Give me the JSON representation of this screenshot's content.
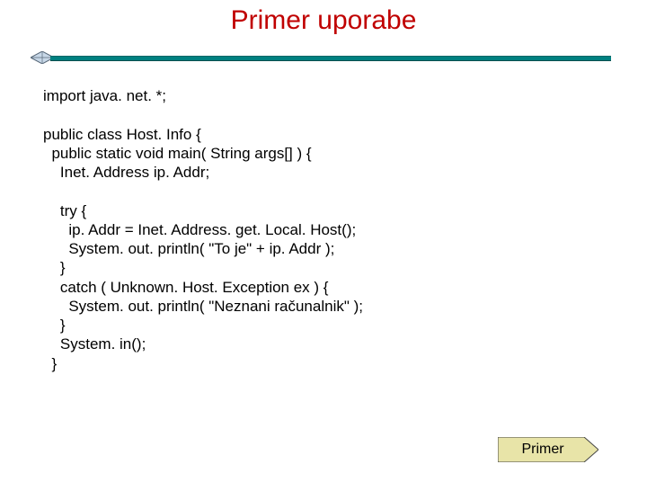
{
  "title": "Primer uporabe",
  "code": "import java. net. *;\n\npublic class Host. Info {\n  public static void main( String args[] ) {\n    Inet. Address ip. Addr;\n\n    try {\n      ip. Addr = Inet. Address. get. Local. Host();\n      System. out. println( \"To je\" + ip. Addr );\n    }\n    catch ( Unknown. Host. Exception ex ) {\n      System. out. println( \"Neznani računalnik\" );\n    }\n    System. in();\n  }",
  "button": {
    "label": "Primer"
  },
  "colors": {
    "title": "#c00000",
    "rule": "#008080",
    "button_fill": "#e8e4a8",
    "button_stroke": "#444"
  }
}
